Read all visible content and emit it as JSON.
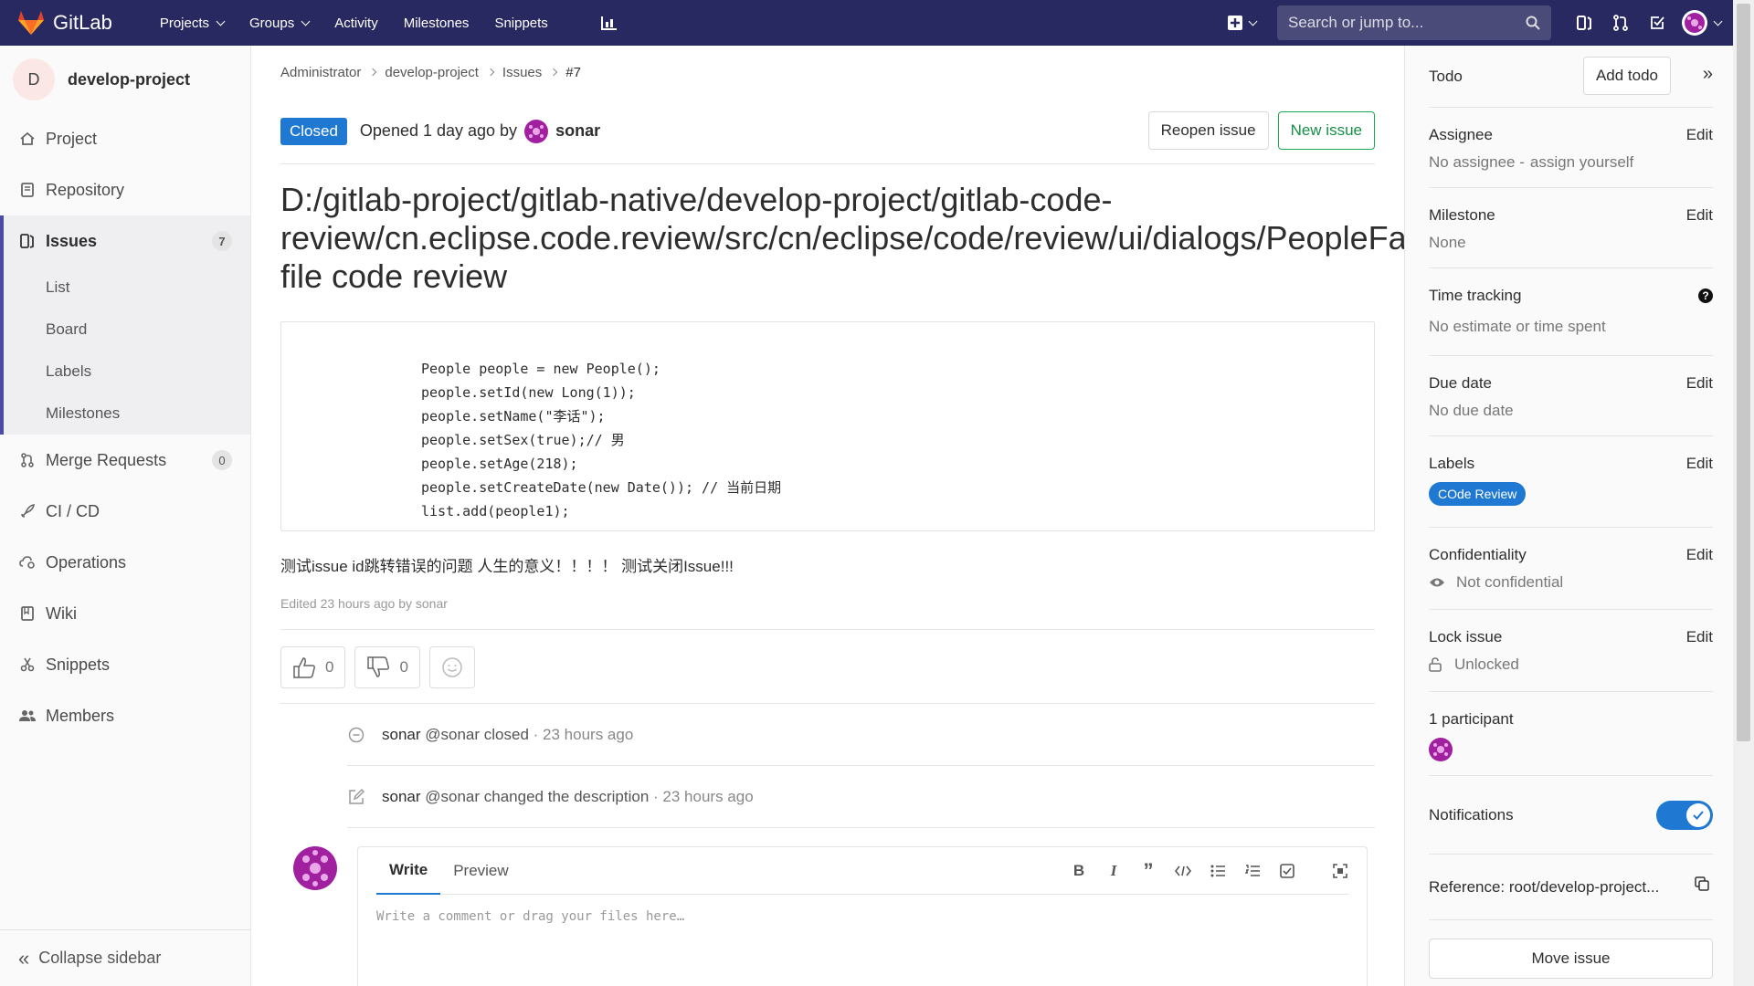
{
  "topnav": {
    "brand": "GitLab",
    "links": [
      {
        "label": "Projects",
        "caret": true
      },
      {
        "label": "Groups",
        "caret": true
      },
      {
        "label": "Activity",
        "caret": false
      },
      {
        "label": "Milestones",
        "caret": false
      },
      {
        "label": "Snippets",
        "caret": false
      }
    ],
    "search_placeholder": "Search or jump to..."
  },
  "sidebar": {
    "project_initial": "D",
    "project_name": "develop-project",
    "items": [
      {
        "label": "Project",
        "icon": "home-icon"
      },
      {
        "label": "Repository",
        "icon": "doc-icon"
      },
      {
        "label": "Issues",
        "icon": "issues-icon",
        "badge": "7"
      },
      {
        "label": "Merge Requests",
        "icon": "merge-request-icon",
        "badge": "0"
      },
      {
        "label": "CI / CD",
        "icon": "rocket-icon"
      },
      {
        "label": "Operations",
        "icon": "cloud-gear-icon"
      },
      {
        "label": "Wiki",
        "icon": "book-icon"
      },
      {
        "label": "Snippets",
        "icon": "scissors-icon"
      },
      {
        "label": "Members",
        "icon": "users-icon"
      }
    ],
    "issues_sub": [
      "List",
      "Board",
      "Labels",
      "Milestones"
    ],
    "collapse_label": "Collapse sidebar"
  },
  "breadcrumb": [
    "Administrator",
    "develop-project",
    "Issues",
    "#7"
  ],
  "issue": {
    "status": "Closed",
    "opened_text": "Opened 1 day ago by",
    "author": "sonar",
    "reopen_label": "Reopen issue",
    "new_issue_label": "New issue",
    "title_lines": [
      "D:/gitlab-project/gitlab-native/develop-project/gitlab-code-",
      "review/cn.eclipse.code.review/src/cn/eclipse/code/review/ui/dialogs/PeopleFa",
      "file code review"
    ],
    "code_lines": [
      "People people = new People();",
      "people.setId(new Long(1));",
      "people.setName(\"李话\");",
      "people.setSex(true);// 男",
      "people.setAge(218);",
      "people.setCreateDate(new Date()); // 当前日期",
      "list.add(people1);"
    ],
    "description": "测试issue id跳转错误的问题 人生的意义！！！！ 测试关闭Issue!!!",
    "edited_text": "Edited 23 hours ago by sonar",
    "thumbs_up": "0",
    "thumbs_down": "0"
  },
  "notes": [
    {
      "icon": "status-closed-icon",
      "user": "sonar",
      "text": "@sonar closed",
      "time": "· 23 hours ago"
    },
    {
      "icon": "pencil-square-icon",
      "user": "sonar",
      "text": "@sonar changed the description",
      "time": "· 23 hours ago"
    }
  ],
  "editor": {
    "tab_write": "Write",
    "tab_preview": "Preview",
    "placeholder": "Write a comment or drag your files here…"
  },
  "right": {
    "todo_label": "Todo",
    "add_todo": "Add todo",
    "assignee_title": "Assignee",
    "assignee_value": "No assignee -",
    "assign_yourself": "assign yourself",
    "milestone_title": "Milestone",
    "milestone_value": "None",
    "time_title": "Time tracking",
    "time_value": "No estimate or time spent",
    "due_title": "Due date",
    "due_value": "No due date",
    "labels_title": "Labels",
    "label_pill": "COde Review",
    "conf_title": "Confidentiality",
    "conf_value": "Not confidential",
    "lock_title": "Lock issue",
    "lock_value": "Unlocked",
    "participants_title": "1 participant",
    "notifications_title": "Notifications",
    "reference": "Reference: root/develop-project...",
    "move_issue": "Move issue",
    "edit": "Edit",
    "accent": "#1f78d1"
  }
}
